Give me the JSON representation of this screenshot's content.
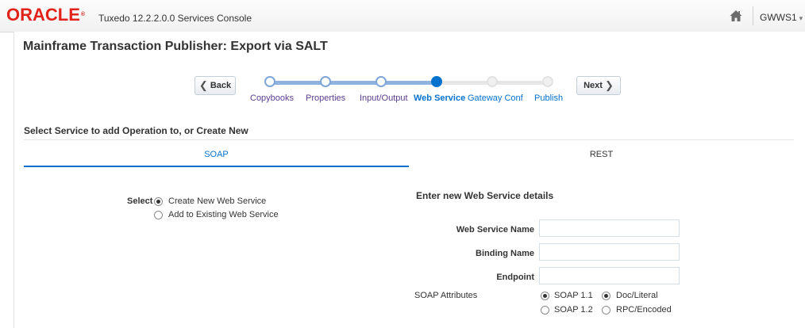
{
  "header": {
    "logo_text": "ORACLE",
    "logo_mark": "®",
    "app_title": "Tuxedo 12.2.2.0.0 Services Console",
    "home_icon": "home-icon",
    "user_label": "GWWS1",
    "user_caret": "▾"
  },
  "page": {
    "title": "Mainframe Transaction Publisher: Export via SALT"
  },
  "train": {
    "back_label": "Back",
    "next_label": "Next",
    "back_chevron": "❮",
    "next_chevron": "❯",
    "stops": [
      {
        "label": "Copybooks",
        "state": "visited"
      },
      {
        "label": "Properties",
        "state": "visited"
      },
      {
        "label": "Input/Output",
        "state": "visited"
      },
      {
        "label": "Web Service",
        "state": "current"
      },
      {
        "label": "Gateway Conf",
        "state": "future"
      },
      {
        "label": "Publish",
        "state": "future"
      }
    ],
    "colors": {
      "visited_line": "#8fb3de",
      "future_line": "#e6e6e6",
      "current": "#0572ce"
    }
  },
  "section": {
    "heading": "Select Service to add Operation to, or Create New"
  },
  "tabs": [
    {
      "label": "SOAP",
      "selected": true
    },
    {
      "label": "REST",
      "selected": false
    }
  ],
  "select_group": {
    "label": "Select",
    "options": [
      {
        "label": "Create New Web Service",
        "checked": true
      },
      {
        "label": "Add to Existing Web Service",
        "checked": false
      }
    ]
  },
  "details": {
    "heading": "Enter new Web Service details",
    "fields": [
      {
        "label": "Web Service Name",
        "value": ""
      },
      {
        "label": "Binding Name",
        "value": ""
      },
      {
        "label": "Endpoint",
        "value": ""
      }
    ],
    "soap_attributes": {
      "label": "SOAP Attributes",
      "version_options": [
        {
          "label": "SOAP 1.1",
          "checked": true
        },
        {
          "label": "SOAP 1.2",
          "checked": false
        }
      ],
      "style_options": [
        {
          "label": "Doc/Literal",
          "checked": true
        },
        {
          "label": "RPC/Encoded",
          "checked": false
        }
      ]
    }
  }
}
